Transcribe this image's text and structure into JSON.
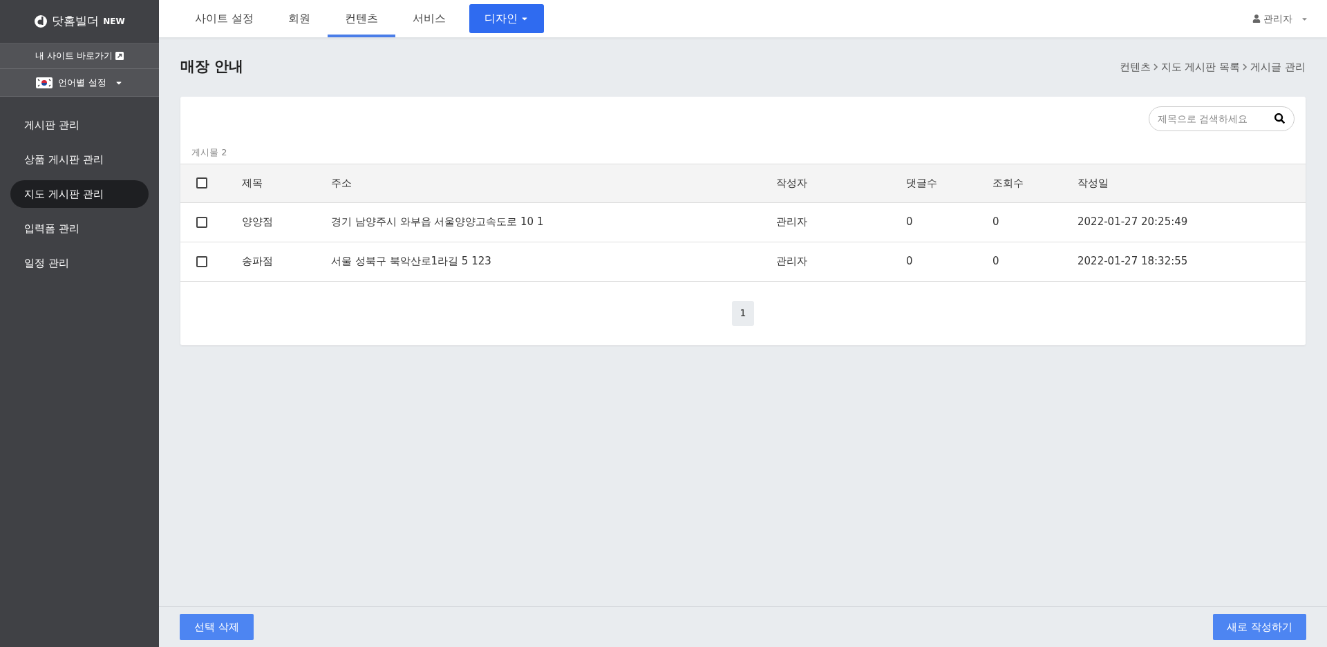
{
  "sidebar": {
    "logo": "닷홈빌더",
    "logo_badge": "NEW",
    "site_link": "내 사이트 바로가기",
    "language": "언어별 설정",
    "menu": [
      {
        "label": "게시판 관리",
        "selected": false
      },
      {
        "label": "상품 게시판 관리",
        "selected": false
      },
      {
        "label": "지도 게시판 관리",
        "selected": true
      },
      {
        "label": "입력폼 관리",
        "selected": false
      },
      {
        "label": "일정 관리",
        "selected": false
      }
    ]
  },
  "topnav": {
    "tabs": [
      {
        "label": "사이트 설정",
        "kind": "tab",
        "selected": false
      },
      {
        "label": "회원",
        "kind": "tab",
        "selected": false
      },
      {
        "label": "컨텐츠",
        "kind": "tab",
        "selected": true
      },
      {
        "label": "서비스",
        "kind": "tab",
        "selected": false
      },
      {
        "label": "디자인",
        "kind": "dropdown",
        "selected": false
      }
    ],
    "user": "관리자"
  },
  "page": {
    "title": "매장 안내",
    "breadcrumb": [
      "컨텐츠",
      "지도 게시판 목록",
      "게시글 관리"
    ]
  },
  "search": {
    "placeholder": "제목으로 검색하세요"
  },
  "count": "게시물 2",
  "table": {
    "header_checked": false,
    "columns": [
      "제목",
      "주소",
      "작성자",
      "댓글수",
      "조회수",
      "작성일"
    ],
    "rows": [
      {
        "checked": false,
        "cells": [
          "양양점",
          "경기 남양주시 와부읍 서울양양고속도로 10 1",
          "관리자",
          "0",
          "0",
          "2022-01-27 20:25:49"
        ]
      },
      {
        "checked": false,
        "cells": [
          "송파점",
          "서울 성북구 북악산로1라길 5 123",
          "관리자",
          "0",
          "0",
          "2022-01-27 18:32:55"
        ]
      }
    ]
  },
  "pagination": [
    {
      "label": "1",
      "selected": true
    }
  ],
  "footer": {
    "delete_button": "선택 삭제",
    "new_button": "새로 작성하기"
  }
}
